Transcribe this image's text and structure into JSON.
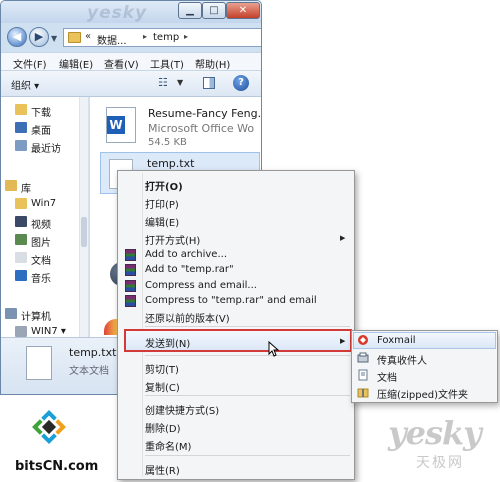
{
  "address_bar": {
    "segment_1": "数据...",
    "segment_2": "temp"
  },
  "menubar": {
    "file": "文件(F)",
    "edit": "编辑(E)",
    "view": "查看(V)",
    "tools": "工具(T)",
    "help": "帮助(H)"
  },
  "command_bar": {
    "organize": "组织 ▾"
  },
  "nav_pane": {
    "items": [
      {
        "label": "下载",
        "icon": "download-folder-icon",
        "color": "#e9c25a"
      },
      {
        "label": "桌面",
        "icon": "desktop-icon",
        "color": "#3c6fb4"
      },
      {
        "label": "最近访",
        "icon": "recent-places-icon",
        "color": "#7d9cc4"
      },
      {
        "label": "库",
        "icon": "libraries-icon",
        "color": "#e3b955"
      },
      {
        "label": "Win7",
        "icon": "library-folder-icon",
        "color": "#e9c25a"
      },
      {
        "label": "视频",
        "icon": "videos-icon",
        "color": "#3a4a66"
      },
      {
        "label": "图片",
        "icon": "pictures-icon",
        "color": "#5a8a4e"
      },
      {
        "label": "文档",
        "icon": "documents-icon",
        "color": "#d9dde4"
      },
      {
        "label": "音乐",
        "icon": "music-icon",
        "color": "#2e6ec0"
      },
      {
        "label": "计算机",
        "icon": "computer-icon",
        "color": "#7a93b2"
      },
      {
        "label": "WIN7 ▾",
        "icon": "drive-icon",
        "color": "#9aa6b6"
      }
    ]
  },
  "files": {
    "word_doc": {
      "name": "Resume-Fancy Feng...",
      "type": "Microsoft Office Wo",
      "size": "54.5 KB"
    },
    "temp_txt": {
      "name": "temp.txt"
    }
  },
  "details_pane": {
    "name": "temp.txt",
    "type": "文本文档"
  },
  "context_menu": {
    "open": "打开(O)",
    "print": "打印(P)",
    "edit": "编辑(E)",
    "open_with": "打开方式(H)",
    "add_to_archive": "Add to archive...",
    "add_to_temp_rar": "Add to \"temp.rar\"",
    "compress_email": "Compress and email...",
    "compress_temp_email": "Compress to \"temp.rar\" and email",
    "restore_previous": "还原以前的版本(V)",
    "send_to": "发送到(N)",
    "cut": "剪切(T)",
    "copy": "复制(C)",
    "create_shortcut": "创建快捷方式(S)",
    "delete": "删除(D)",
    "rename": "重命名(M)",
    "properties": "属性(R)"
  },
  "send_to_menu": {
    "foxmail": "Foxmail",
    "fax_recipient": "传真收件人",
    "documents": "文档",
    "zip_folder": "压缩(zipped)文件夹"
  },
  "logos": {
    "bitscn": "bitsCN.com",
    "yesky": "yesky",
    "yesky_sub": "天极网"
  },
  "colors": {
    "highlight_border": "#d23a3a",
    "selection": "#dce9f8",
    "window_frame": "#cfe0f1"
  }
}
